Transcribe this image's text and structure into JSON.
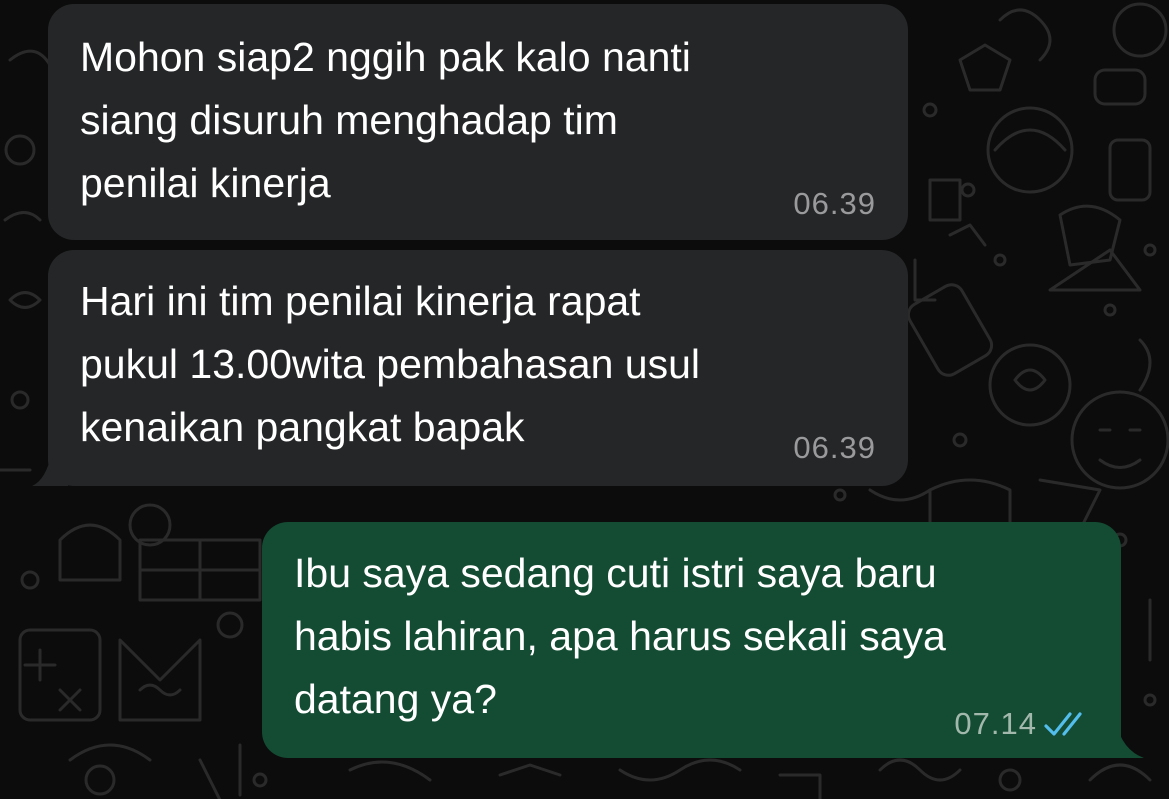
{
  "messages": [
    {
      "direction": "incoming",
      "text": "Mohon siap2 nggih pak kalo nanti\nsiang disuruh menghadap tim\npenilai kinerja",
      "time": "06.39"
    },
    {
      "direction": "incoming",
      "text": "Hari ini tim penilai kinerja rapat\npukul 13.00wita pembahasan usul\nkenaikan pangkat bapak",
      "time": "06.39"
    },
    {
      "direction": "outgoing",
      "text": "Ibu saya sedang cuti istri saya baru\nhabis lahiran, apa harus sekali saya\ndatang ya?",
      "time": "07.14",
      "status_icon": "double-check-read-icon"
    }
  ],
  "colors": {
    "background": "#0c0c0c",
    "incoming_bubble": "#252628",
    "outgoing_bubble": "#134b33",
    "read_ticks": "#53bdeb"
  }
}
